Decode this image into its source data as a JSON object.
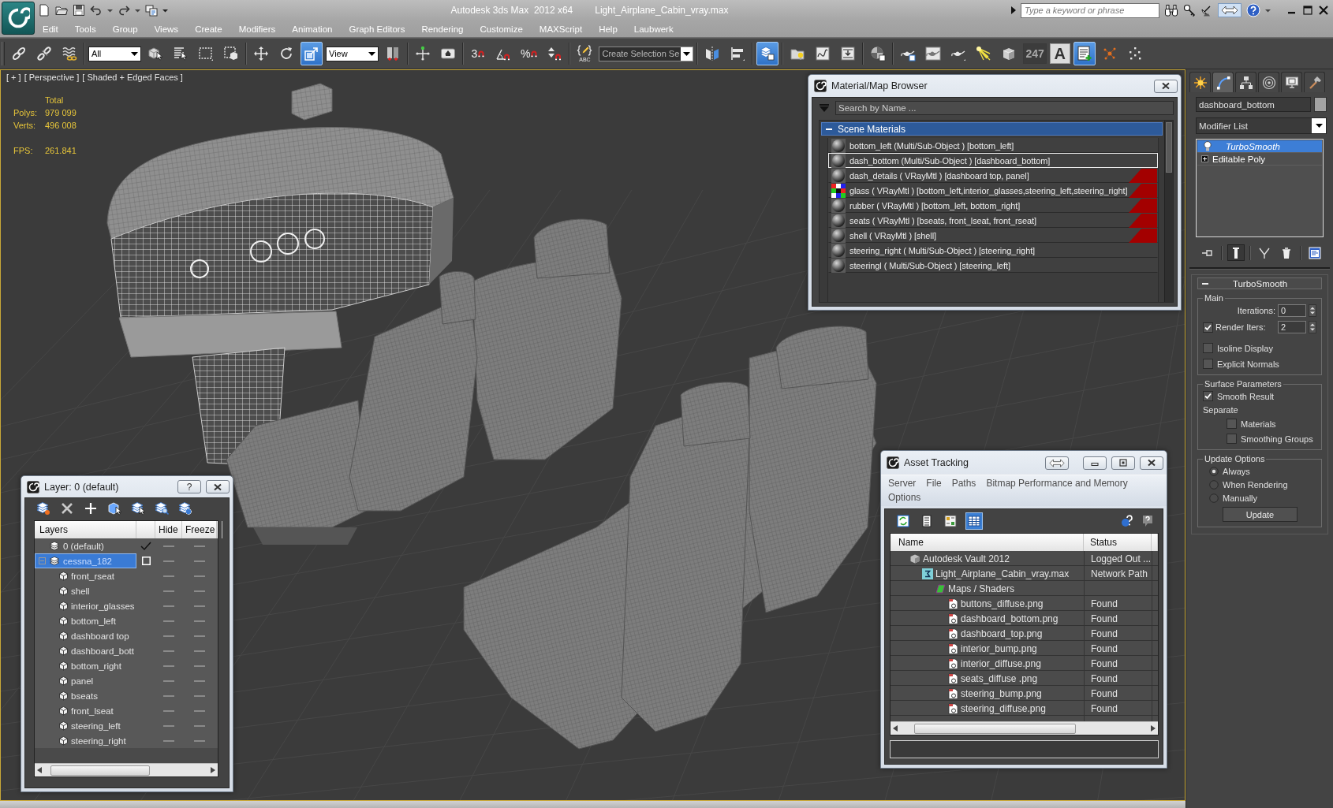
{
  "window": {
    "title": "Autodesk 3ds Max  2012 x64",
    "file": "Light_Airplane_Cabin_vray.max"
  },
  "search": {
    "placeholder": "Type a keyword or phrase"
  },
  "menu": [
    "Edit",
    "Tools",
    "Group",
    "Views",
    "Create",
    "Modifiers",
    "Animation",
    "Graph Editors",
    "Rendering",
    "Customize",
    "MAXScript",
    "Help",
    "Laubwerk"
  ],
  "toolbar": [
    {
      "kind": "button",
      "on": false
    },
    {
      "kind": "button",
      "on": false
    },
    {
      "kind": "button",
      "on": false
    },
    {
      "kind": "dropdown",
      "value": "All"
    },
    {
      "kind": "button",
      "on": false
    },
    {
      "kind": "button",
      "on": false
    },
    {
      "kind": "button",
      "on": false
    },
    {
      "kind": "button",
      "on": false
    },
    {
      "kind": "button",
      "on": false
    },
    {
      "kind": "button",
      "on": false
    },
    {
      "kind": "button",
      "on": true
    },
    {
      "kind": "dropdown",
      "value": "View"
    },
    {
      "kind": "button",
      "on": false
    },
    {
      "kind": "button",
      "on": false
    },
    {
      "kind": "button",
      "on": false
    },
    {
      "kind": "snap",
      "label": "3",
      "on": false
    },
    {
      "kind": "button",
      "on": false
    },
    {
      "kind": "snap",
      "label": "%",
      "on": false
    },
    {
      "kind": "button",
      "on": false
    },
    {
      "kind": "caption",
      "label": "ABC",
      "on": false
    },
    {
      "kind": "field",
      "value": "Create Selection Se"
    },
    {
      "kind": "button",
      "on": false
    },
    {
      "kind": "button",
      "on": false
    },
    {
      "kind": "button",
      "on": true
    },
    {
      "kind": "button",
      "on": false
    },
    {
      "kind": "button",
      "on": false
    },
    {
      "kind": "button",
      "on": false
    },
    {
      "kind": "button",
      "on": false
    },
    {
      "kind": "button",
      "on": false
    },
    {
      "kind": "button",
      "on": false
    },
    {
      "kind": "button",
      "on": false
    },
    {
      "kind": "button",
      "on": false
    },
    {
      "kind": "button",
      "on": false
    },
    {
      "kind": "text",
      "label": "247",
      "on": false
    },
    {
      "kind": "text",
      "label": "A",
      "on": false
    },
    {
      "kind": "button",
      "on": true
    },
    {
      "kind": "button",
      "on": false
    },
    {
      "kind": "button",
      "on": false
    }
  ],
  "viewport": {
    "active": true,
    "labels": [
      "[ + ]",
      "[ Perspective ]",
      "[ Shaded + Edged Faces ]"
    ],
    "stats": {
      "header": "Total",
      "rows": [
        {
          "label": "Polys:",
          "value": "979 099"
        },
        {
          "label": "Verts:",
          "value": "496 008"
        }
      ],
      "fps": {
        "label": "FPS:",
        "value": "261.841"
      }
    }
  },
  "material_browser": {
    "title": "Material/Map Browser",
    "search": {
      "placeholder": "Search by Name ..."
    },
    "group": {
      "label": "Scene Materials",
      "expanded": true
    },
    "materials": [
      {
        "label": "bottom_left (Multi/Sub-Object ) [bottom_left]",
        "kind": "sphere",
        "selected": false,
        "flag": false
      },
      {
        "label": "dash_bottom (Multi/Sub-Object ) [dashboard_bottom]",
        "kind": "sphere",
        "selected": true,
        "flag": false
      },
      {
        "label": "dash_details ( VRayMtl ) [dashboard top, panel]",
        "kind": "sphere",
        "selected": false,
        "flag": true
      },
      {
        "label": "glass ( VRayMtl ) [bottom_left,interior_glasses,steering_left,steering_right]",
        "kind": "checker",
        "selected": false,
        "flag": true
      },
      {
        "label": "rubber ( VRayMtl ) [bottom_left, bottom_right]",
        "kind": "sphere",
        "selected": false,
        "flag": true
      },
      {
        "label": "seats ( VRayMtl ) [bseats, front_lseat, front_rseat]",
        "kind": "sphere",
        "selected": false,
        "flag": true
      },
      {
        "label": "shell ( VRayMtl ) [shell]",
        "kind": "sphere",
        "selected": false,
        "flag": true
      },
      {
        "label": "steering_right ( Multi/Sub-Object ) [steering_right]",
        "kind": "sphere",
        "selected": false,
        "flag": false
      },
      {
        "label": "steeringl ( Multi/Sub-Object ) [steering_left]",
        "kind": "sphere",
        "selected": false,
        "flag": false
      }
    ]
  },
  "layer_window": {
    "title": "Layer: 0 (default)",
    "help_button": "?",
    "columns": [
      "Layers",
      "Hide",
      "Freeze"
    ],
    "layers": [
      {
        "name": "0 (default)",
        "current": true,
        "selected": false,
        "hidden": false,
        "frozen": false
      },
      {
        "name": "cessna_182",
        "current": false,
        "selected": true,
        "expanded": true,
        "hidden": false,
        "frozen": false,
        "children": [
          {
            "name": "front_rseat",
            "selected": false,
            "hidden": false,
            "frozen": false
          },
          {
            "name": "shell",
            "selected": false,
            "hidden": false,
            "frozen": false
          },
          {
            "name": "interior_glasses",
            "selected": false,
            "hidden": false,
            "frozen": false
          },
          {
            "name": "bottom_left",
            "selected": false,
            "hidden": false,
            "frozen": false
          },
          {
            "name": "dashboard top",
            "selected": false,
            "hidden": false,
            "frozen": false
          },
          {
            "name": "dashboard_bott",
            "selected": false,
            "hidden": false,
            "frozen": false
          },
          {
            "name": "bottom_right",
            "selected": false,
            "hidden": false,
            "frozen": false
          },
          {
            "name": "panel",
            "selected": false,
            "hidden": false,
            "frozen": false
          },
          {
            "name": "bseats",
            "selected": false,
            "hidden": false,
            "frozen": false
          },
          {
            "name": "front_lseat",
            "selected": false,
            "hidden": false,
            "frozen": false
          },
          {
            "name": "steering_left",
            "selected": false,
            "hidden": false,
            "frozen": false
          },
          {
            "name": "steering_right",
            "selected": false,
            "hidden": false,
            "frozen": false
          }
        ]
      }
    ]
  },
  "asset_tracking": {
    "title": "Asset Tracking",
    "menu": [
      "Server",
      "File",
      "Paths",
      "Bitmap Performance and Memory",
      "Options"
    ],
    "view_buttons": [
      {
        "selected": false
      },
      {
        "selected": false
      },
      {
        "selected": false
      },
      {
        "selected": true
      }
    ],
    "columns": [
      "Name",
      "Status"
    ],
    "assets": [
      {
        "name": "Autodesk Vault 2012",
        "kind": "vault",
        "status": "Logged Out ...",
        "children": [
          {
            "name": "Light_Airplane_Cabin_vray.max",
            "kind": "scene",
            "status": "Network Path",
            "children": [
              {
                "name": "Maps / Shaders",
                "kind": "folder",
                "children": [
                  {
                    "name": "buttons_diffuse.png",
                    "kind": "bitmap",
                    "status": "Found"
                  },
                  {
                    "name": "dashboard_bottom.png",
                    "kind": "bitmap",
                    "status": "Found"
                  },
                  {
                    "name": "dashboard_top.png",
                    "kind": "bitmap",
                    "status": "Found"
                  },
                  {
                    "name": "interior_bump.png",
                    "kind": "bitmap",
                    "status": "Found"
                  },
                  {
                    "name": "interior_diffuse.png",
                    "kind": "bitmap",
                    "status": "Found"
                  },
                  {
                    "name": "seats_diffuse .png",
                    "kind": "bitmap",
                    "status": "Found"
                  },
                  {
                    "name": "steering_bump.png",
                    "kind": "bitmap",
                    "status": "Found"
                  },
                  {
                    "name": "steering_diffuse.png",
                    "kind": "bitmap",
                    "status": "Found"
                  }
                ]
              }
            ]
          }
        ]
      }
    ]
  },
  "command_panel": {
    "tabs": [
      {
        "selected": false
      },
      {
        "selected": true
      },
      {
        "selected": false
      },
      {
        "selected": false
      },
      {
        "selected": false
      },
      {
        "selected": false
      }
    ],
    "object_name": "dashboard_bottom",
    "modifier_list": "Modifier List",
    "stack": [
      {
        "name": "TurboSmooth",
        "kind": "modifier",
        "selected": true,
        "on": true
      },
      {
        "name": "Editable Poly",
        "kind": "base",
        "selected": false,
        "expanded": false
      }
    ],
    "stack_buttons": [
      {
        "on": false
      },
      {
        "on": true
      },
      {
        "on": false
      },
      {
        "on": false
      },
      {
        "on": false
      }
    ],
    "rollout": {
      "title": "TurboSmooth",
      "expanded": true,
      "main": {
        "label": "Main",
        "iterations": {
          "label": "Iterations:",
          "value": "0"
        },
        "render_iters": {
          "label": "Render Iters:",
          "value": "2",
          "checked": true
        },
        "options": [
          {
            "label": "Isoline Display",
            "checked": false
          },
          {
            "label": "Explicit Normals",
            "checked": false
          }
        ]
      },
      "surface": {
        "label": "Surface Parameters",
        "smooth_result": {
          "label": "Smooth Result",
          "checked": true
        },
        "separate": {
          "label": "Separate",
          "options": [
            {
              "label": "Materials",
              "checked": false
            },
            {
              "label": "Smoothing Groups",
              "checked": false
            }
          ]
        }
      },
      "update": {
        "label": "Update Options",
        "options": [
          {
            "label": "Always",
            "selected": true
          },
          {
            "label": "When Rendering",
            "selected": false
          },
          {
            "label": "Manually",
            "selected": false
          }
        ],
        "button": "Update"
      }
    }
  }
}
